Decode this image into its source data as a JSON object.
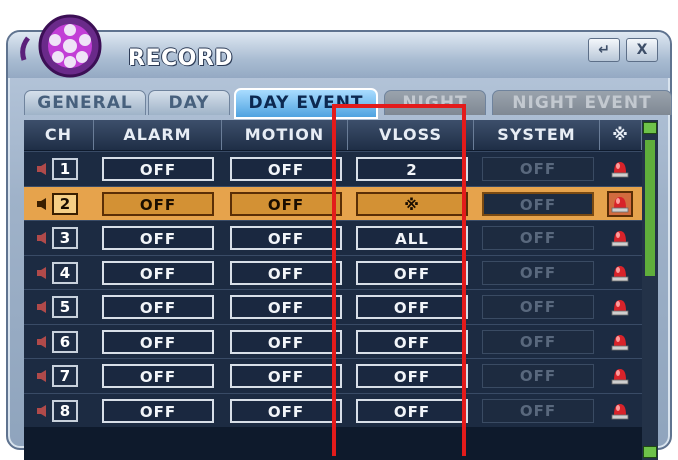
{
  "window": {
    "title": "RECORD",
    "enter_button": "↵",
    "close_button": "X"
  },
  "tabs": [
    {
      "label": "GENERAL",
      "state": "normal"
    },
    {
      "label": "DAY",
      "state": "normal"
    },
    {
      "label": "DAY EVENT",
      "state": "active"
    },
    {
      "label": "NIGHT",
      "state": "disabled"
    },
    {
      "label": "NIGHT EVENT",
      "state": "disabled"
    }
  ],
  "table": {
    "headers": {
      "ch": "CH",
      "alarm": "ALARM",
      "motion": "MOTION",
      "vloss": "VLOSS",
      "system": "SYSTEM",
      "all": "※"
    },
    "rows": [
      {
        "ch": "1",
        "alarm": "OFF",
        "motion": "OFF",
        "vloss": "2",
        "system": "OFF",
        "selected": false
      },
      {
        "ch": "2",
        "alarm": "OFF",
        "motion": "OFF",
        "vloss": "※",
        "system": "OFF",
        "selected": true
      },
      {
        "ch": "3",
        "alarm": "OFF",
        "motion": "OFF",
        "vloss": "ALL",
        "system": "OFF",
        "selected": false
      },
      {
        "ch": "4",
        "alarm": "OFF",
        "motion": "OFF",
        "vloss": "OFF",
        "system": "OFF",
        "selected": false
      },
      {
        "ch": "5",
        "alarm": "OFF",
        "motion": "OFF",
        "vloss": "OFF",
        "system": "OFF",
        "selected": false
      },
      {
        "ch": "6",
        "alarm": "OFF",
        "motion": "OFF",
        "vloss": "OFF",
        "system": "OFF",
        "selected": false
      },
      {
        "ch": "7",
        "alarm": "OFF",
        "motion": "OFF",
        "vloss": "OFF",
        "system": "OFF",
        "selected": false
      },
      {
        "ch": "8",
        "alarm": "OFF",
        "motion": "OFF",
        "vloss": "OFF",
        "system": "OFF",
        "selected": false
      }
    ]
  },
  "icons": {
    "logo": "film-reel-logo-icon",
    "row_left": "speaker-icon",
    "row_right": "siren-alarm-icon"
  },
  "colors": {
    "accent": "#4fa3e0",
    "selection": "#e6a34c",
    "highlight_box": "#e31b1b",
    "scrollbar": "#6ec24a"
  }
}
